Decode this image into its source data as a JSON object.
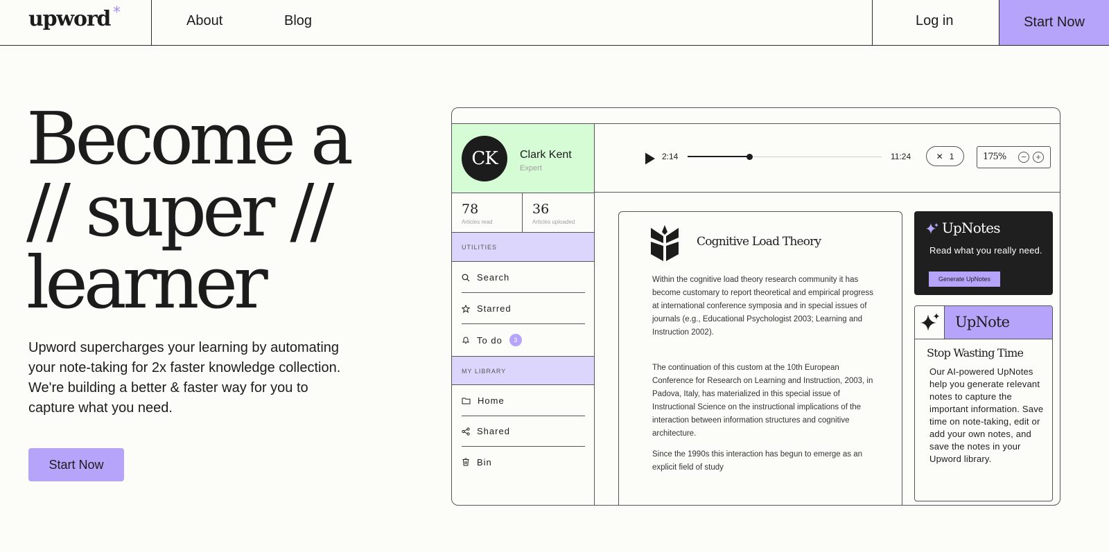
{
  "nav": {
    "logo": "upword",
    "logo_mark": "*",
    "links": [
      "About",
      "Blog"
    ],
    "login": "Log in",
    "start": "Start Now"
  },
  "hero": {
    "title_lines": [
      "Become a",
      "// super //",
      "learner"
    ],
    "text": "Upword supercharges your learning by automating your note-taking for 2x faster knowledge collection. We're building a better & faster way for you to capture what you need.",
    "cta": "Start Now"
  },
  "app": {
    "profile": {
      "initials": "CK",
      "name": "Clark Kent",
      "role": "Expert"
    },
    "stats": [
      {
        "value": "78",
        "label": "Articles read"
      },
      {
        "value": "36",
        "label": "Articles uploaded"
      }
    ],
    "utilities_label": "UTILITIES",
    "utilities": [
      {
        "icon": "search-icon",
        "label": "Search"
      },
      {
        "icon": "star-icon",
        "label": "Starred"
      },
      {
        "icon": "bell-icon",
        "label": "To do",
        "badge": "3"
      }
    ],
    "library_label": "MY LIBRARY",
    "library": [
      {
        "icon": "folder-icon",
        "label": "Home"
      },
      {
        "icon": "share-icon",
        "label": "Shared"
      },
      {
        "icon": "trash-icon",
        "label": "Bin"
      }
    ],
    "player": {
      "current": "2:14",
      "total": "11:24",
      "progress": 0.32,
      "speed_symbol": "✕",
      "speed": "1",
      "zoom": "175%"
    },
    "document": {
      "title": "Cognitive Load Theory",
      "paragraphs": [
        "Within the cognitive load theory research community it has become customary to report theoretical and empirical progress at international conference symposia and in special issues of journals (e.g., Educational Psychologist 2003; Learning and Instruction 2002).",
        "The continuation of this custom at the 10th European Conference for Research on Learning and Instruction, 2003, in Padova, Italy, has materialized in this special issue of Instructional Science on the instructional implications of the interaction between information structures and cognitive architecture.",
        "Since the 1990s this interaction has begun to emerge as an explicit field of study"
      ]
    },
    "upnotes_card": {
      "title": "UpNotes",
      "text": "Read what you really need.",
      "button": "Generate UpNotes"
    },
    "upnote_card": {
      "title": "UpNote",
      "subtitle": "Stop Wasting Time",
      "text": "Our AI-powered UpNotes help you generate relevant notes to capture the important information. Save time on note-taking, edit or add your own notes, and save the notes in your Upword library."
    },
    "colors": {
      "accent": "#b6a4fa",
      "lavender": "#ddd6fc",
      "mint": "#d6fcd6",
      "dark": "#1f1f1f"
    }
  }
}
